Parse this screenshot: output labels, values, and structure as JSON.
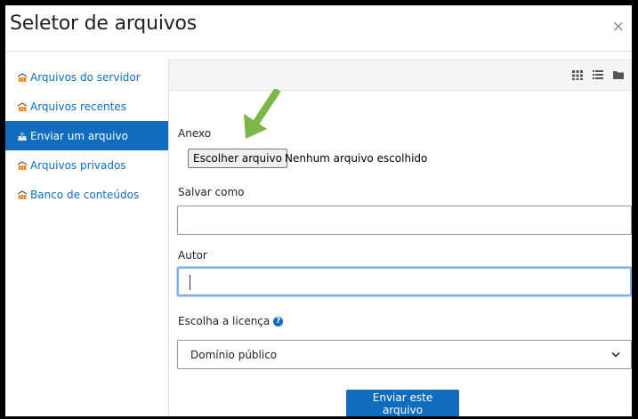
{
  "dialog": {
    "title": "Seletor de arquivos",
    "close_label": "×"
  },
  "sidebar": {
    "items": [
      {
        "label": "Arquivos do servidor",
        "icon": "moodle-icon",
        "active": false
      },
      {
        "label": "Arquivos recentes",
        "icon": "moodle-icon",
        "active": false
      },
      {
        "label": "Enviar um arquivo",
        "icon": "upload-icon",
        "active": true
      },
      {
        "label": "Arquivos privados",
        "icon": "moodle-icon",
        "active": false
      },
      {
        "label": "Banco de conteúdos",
        "icon": "moodle-icon",
        "active": false
      }
    ]
  },
  "toolbar": {
    "views": [
      "grid-view-icon",
      "list-view-icon",
      "folder-view-icon"
    ]
  },
  "form": {
    "attachment_label": "Anexo",
    "choose_file_label": "Escolher arquivo",
    "no_file_text": "Nenhum arquivo escolhido",
    "save_as_label": "Salvar como",
    "save_as_value": "",
    "author_label": "Autor",
    "author_value": "",
    "license_label": "Escolha a licença",
    "license_value": "Domínio público",
    "submit_label": "Enviar este arquivo"
  },
  "colors": {
    "accent": "#0f6cbf",
    "arrow": "#7ab648",
    "moodle_orange": "#f98012"
  }
}
